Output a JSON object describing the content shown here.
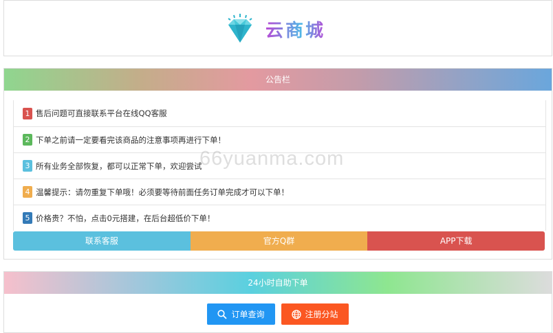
{
  "logo": {
    "text": "云商城",
    "icon": "diamond-icon"
  },
  "notice": {
    "title": "公告栏",
    "items": [
      {
        "num": "1",
        "text": "售后问题可直接联系平台在线QQ客服",
        "color": "#d9534f"
      },
      {
        "num": "2",
        "text": "下单之前请一定要看完该商品的注意事项再进行下单！",
        "color": "#5cb85c"
      },
      {
        "num": "3",
        "text": "所有业务全部恢复，都可以正常下单，欢迎尝试",
        "color": "#5bc0de"
      },
      {
        "num": "4",
        "text": "温馨提示：请勿重复下单哦！必须要等待前面任务订单完成才可以下单！",
        "color": "#f0ad4e"
      },
      {
        "num": "5",
        "text": "价格贵？不怕，点击0元搭建，在后台超低价下单！",
        "color": "#337ab7"
      }
    ],
    "buttons": [
      {
        "label": "联系客服",
        "color": "#5bc0de"
      },
      {
        "label": "官方Q群",
        "color": "#f0ad4e"
      },
      {
        "label": "APP下载",
        "color": "#d9534f"
      }
    ]
  },
  "order": {
    "title": "24小时自助下单",
    "query_label": "订单查询",
    "register_label": "注册分站",
    "query_color": "#2196f3",
    "register_color": "#fb5722"
  },
  "watermark": "66yuanma.com"
}
